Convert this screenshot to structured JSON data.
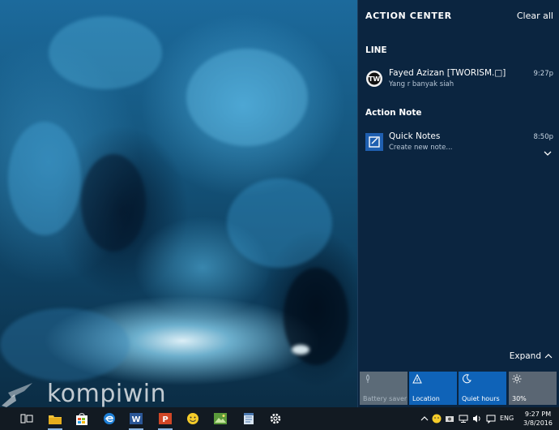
{
  "watermark": "kompiwin",
  "action_center": {
    "title": "ACTION CENTER",
    "clear_all": "Clear all",
    "groups": [
      {
        "name": "LINE",
        "notifications": [
          {
            "icon": "line-app-icon",
            "title": "Fayed Azizan [TWORISM.□]",
            "body": "Yang r banyak siah",
            "time": "9:27p"
          }
        ]
      },
      {
        "name": "Action Note",
        "notifications": [
          {
            "icon": "quick-notes-icon",
            "title": "Quick Notes",
            "body": "Create new note...",
            "time": "8:50p"
          }
        ]
      }
    ],
    "expand": "Expand",
    "quick_actions": [
      {
        "label": "Battery saver",
        "icon": "battery-saver-icon",
        "state": "off"
      },
      {
        "label": "Location",
        "icon": "location-icon",
        "state": "on"
      },
      {
        "label": "Quiet hours",
        "icon": "moon-icon",
        "state": "on"
      },
      {
        "label": "30%",
        "icon": "brightness-icon",
        "state": "neutral"
      }
    ]
  },
  "taskbar": {
    "apps": [
      "task-view-icon",
      "file-explorer-icon",
      "store-icon",
      "edge-icon",
      "word-icon",
      "powerpoint-icon",
      "emoji-app-icon",
      "photo-app-icon",
      "notepad-app-icon",
      "settings-icon"
    ],
    "tray_icons": [
      "chevron-up-icon",
      "emoji-tray-icon",
      "camera-tray-icon",
      "network-icon",
      "volume-icon",
      "message-icon"
    ],
    "language": "ENG",
    "time": "9:27 PM",
    "date": "3/8/2016"
  },
  "colors": {
    "action_center_bg": "#0b2540",
    "tile_on": "#0f63b8",
    "tile_off": "#5c6b78",
    "taskbar_bg": "#121a22"
  }
}
